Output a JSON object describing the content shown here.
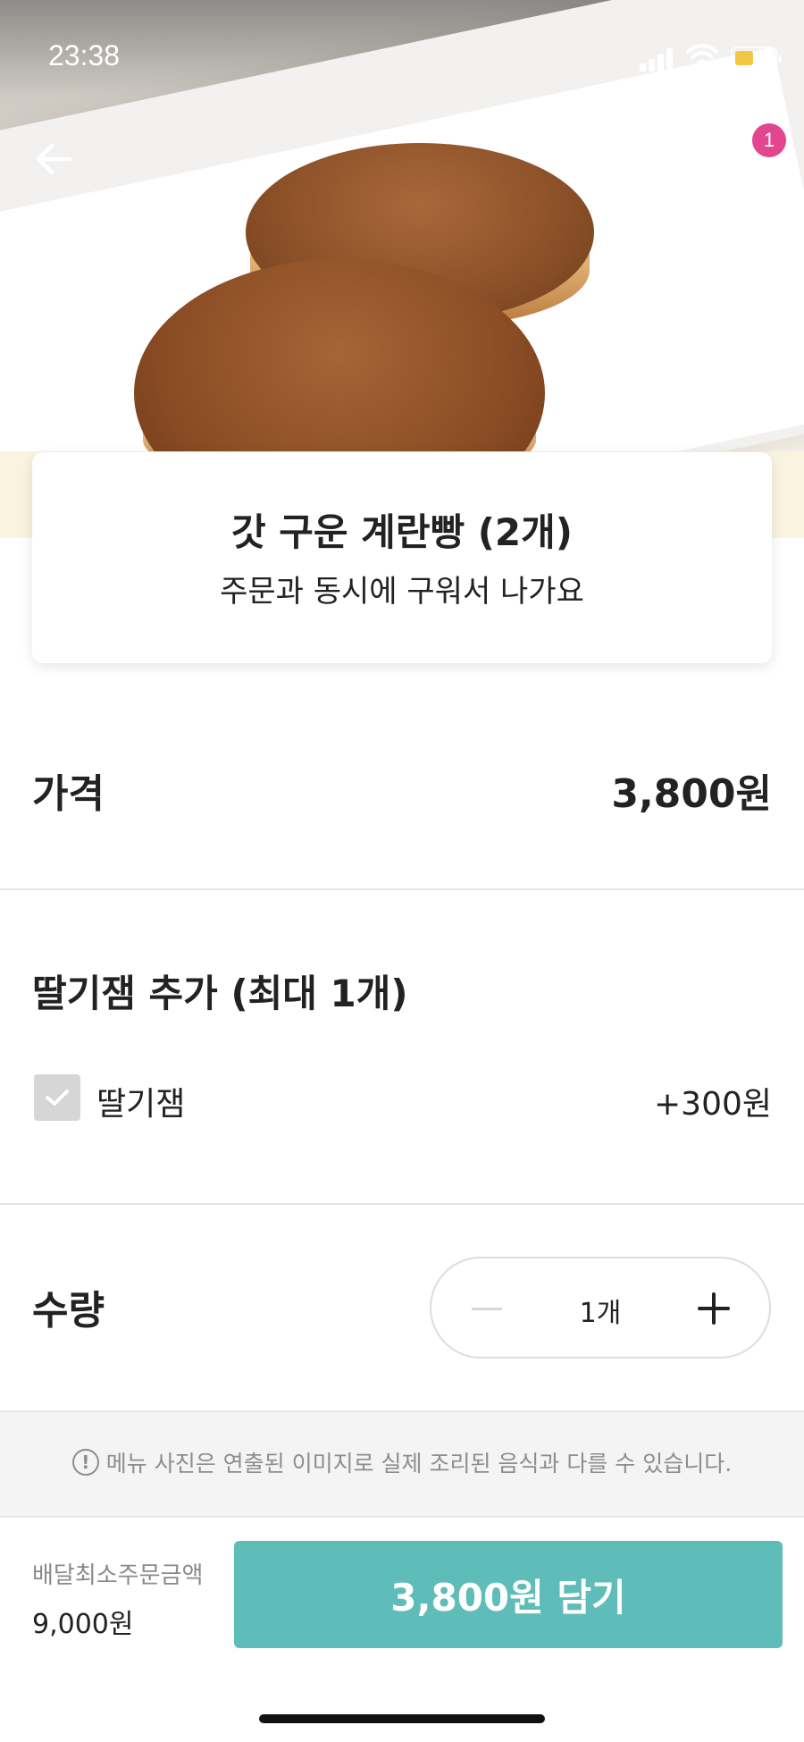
{
  "status_bar": {
    "time": "23:38"
  },
  "header": {
    "cart_count": "1",
    "icons": [
      "back-arrow-icon",
      "home-icon",
      "share-icon",
      "cart-icon"
    ]
  },
  "product": {
    "name": "갓 구운 계란빵 (2개)",
    "description": "주문과 동시에 구워서 나가요"
  },
  "price": {
    "label": "가격",
    "value": "3,800원"
  },
  "options": {
    "title": "딸기잼 추가 (최대 1개)",
    "items": [
      {
        "label": "딸기잼",
        "price": "+300원",
        "checked": false
      }
    ]
  },
  "quantity": {
    "label": "수량",
    "value": "1개"
  },
  "notice": {
    "text": "메뉴 사진은 연출된 이미지로 실제 조리된 음식과 다를 수 있습니다."
  },
  "footer": {
    "min_order_label": "배달최소주문금액",
    "min_order_value": "9,000원",
    "cta_label": "3,800원 담기"
  },
  "colors": {
    "accent": "#5fbdb9",
    "badge": "#e3468e",
    "battery": "#f2c744"
  }
}
